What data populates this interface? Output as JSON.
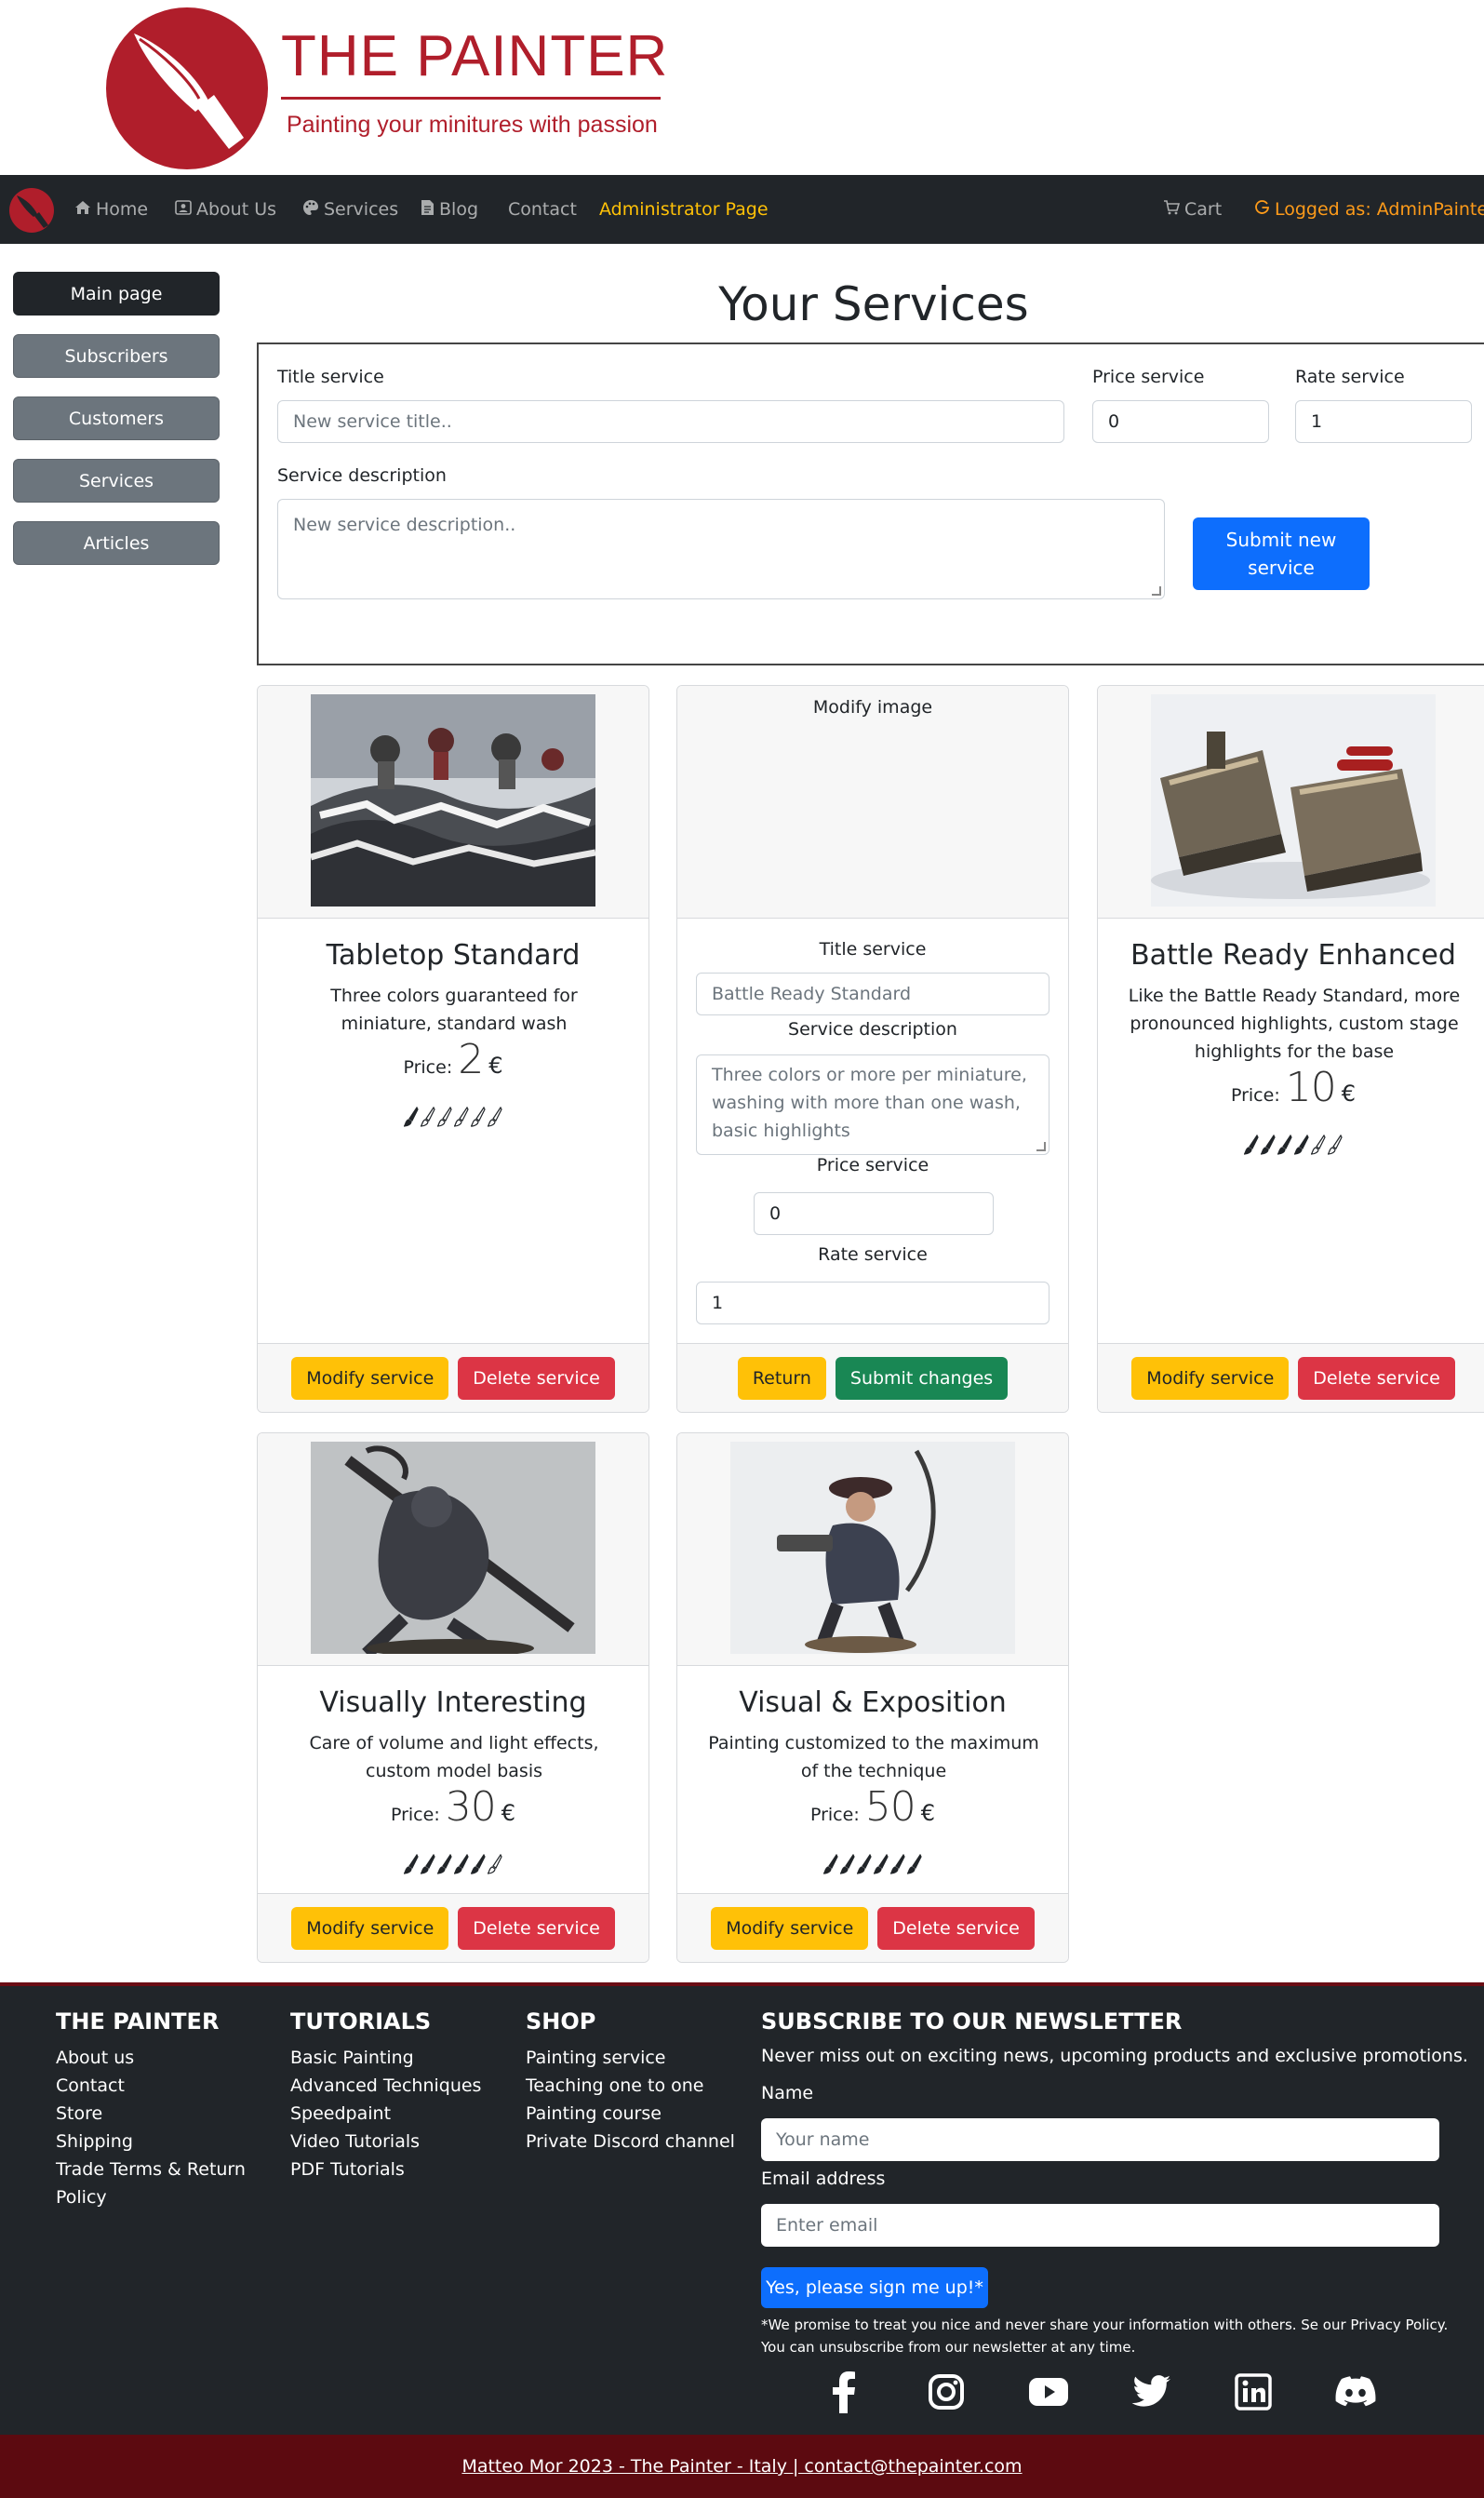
{
  "logo": {
    "title": "THE PAINTER",
    "subtitle": "Painting your minitures with passion"
  },
  "navbar": {
    "home": "Home",
    "about": "About Us",
    "services": "Services",
    "blog": "Blog",
    "contact": "Contact",
    "admin": "Administrator Page",
    "cart": "Cart",
    "user": "Logged as: AdminPainter"
  },
  "sidebar": {
    "items": [
      "Main page",
      "Subscribers",
      "Customers",
      "Services",
      "Articles"
    ]
  },
  "main": {
    "title": "Your Services",
    "new_form": {
      "title_label": "Title service",
      "title_placeholder": "New service title..",
      "price_label": "Price service",
      "price_value": "0",
      "rate_label": "Rate service",
      "rate_value": "1",
      "desc_label": "Service description",
      "desc_placeholder": "New service description..",
      "submit": "Submit new service"
    }
  },
  "cards": [
    {
      "title": "Tabletop Standard",
      "desc": "Three colors guaranteed for miniature, standard wash",
      "price_label": "Price:",
      "price": "2",
      "currency": "€",
      "rating": 1,
      "max_rating": 6,
      "modify": "Modify service",
      "delete": "Delete service"
    },
    {
      "title": "Battle Ready Enhanced",
      "desc": "Like the Battle Ready Standard, more pronounced highlights, custom stage highlights for the base",
      "price_label": "Price:",
      "price": "10",
      "currency": "€",
      "rating": 4,
      "max_rating": 6,
      "modify": "Modify service",
      "delete": "Delete service"
    },
    {
      "title": "Visually Interesting",
      "desc": "Care of volume and light effects, custom model basis",
      "price_label": "Price:",
      "price": "30",
      "currency": "€",
      "rating": 5,
      "max_rating": 6,
      "modify": "Modify service",
      "delete": "Delete service"
    },
    {
      "title": "Visual & Exposition",
      "desc": "Painting customized to the maximum of the technique",
      "price_label": "Price:",
      "price": "50",
      "currency": "€",
      "rating": 6,
      "max_rating": 6,
      "modify": "Modify service",
      "delete": "Delete service"
    }
  ],
  "edit_card": {
    "modify_image": "Modify image",
    "title_label": "Title service",
    "title_value": "Battle Ready Standard",
    "desc_label": "Service description",
    "desc_value": "Three colors or more per miniature, washing with more than one wash, basic highlights",
    "price_label": "Price service",
    "price_value": "0",
    "rate_label": "Rate service",
    "rate_value": "1",
    "return": "Return",
    "submit": "Submit changes"
  },
  "footer": {
    "col1": {
      "head": "THE PAINTER",
      "items": [
        "About us",
        "Contact",
        "Store",
        "Shipping",
        "Trade Terms & Return",
        "Policy"
      ]
    },
    "col2": {
      "head": "TUTORIALS",
      "items": [
        "Basic Painting",
        "Advanced Techniques",
        "Speedpaint",
        "Video Tutorials",
        "PDF Tutorials"
      ]
    },
    "col3": {
      "head": "SHOP",
      "items": [
        "Painting service",
        "Teaching one to one",
        "Painting course",
        "Private Discord channel"
      ]
    },
    "newsletter": {
      "head": "SUBSCRIBE TO OUR NEWSLETTER",
      "text": "Never miss out on exciting news, upcoming products and exclusive promotions.",
      "name_label": "Name",
      "name_placeholder": "Your name",
      "email_label": "Email address",
      "email_placeholder": "Enter email",
      "button": "Yes, please sign me up!*",
      "note1": "*We promise to treat you nice and never share your information with others. Se our Privacy Policy.",
      "note2": "You can unsubscribe from our newsletter at any time."
    },
    "social": [
      "facebook-icon",
      "instagram-icon",
      "youtube-icon",
      "twitter-icon",
      "linkedin-icon",
      "discord-icon"
    ],
    "copyright": "Matteo Mor 2023 - The Painter - Italy | contact@thepainter.com"
  },
  "colors": {
    "brand_red": "#b01e2b",
    "navbar": "#212529",
    "primary": "#0d6efd",
    "warning": "#ffc107",
    "danger": "#dc3545",
    "success": "#198754",
    "bottom_bar": "#5c0a10"
  }
}
